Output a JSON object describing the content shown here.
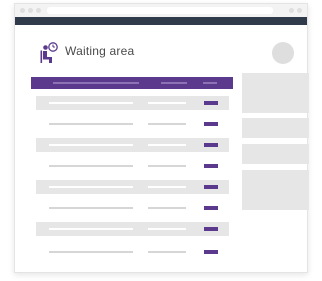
{
  "header": {
    "title": "Waiting area",
    "icon": "seated-person-clock-icon"
  },
  "colors": {
    "accent": "#5b3a8e",
    "topbar": "#2f3a4a",
    "placeholder": "#e6e6e6"
  },
  "table": {
    "row_count": 8
  },
  "sidebar": {
    "panel_count": 4
  }
}
